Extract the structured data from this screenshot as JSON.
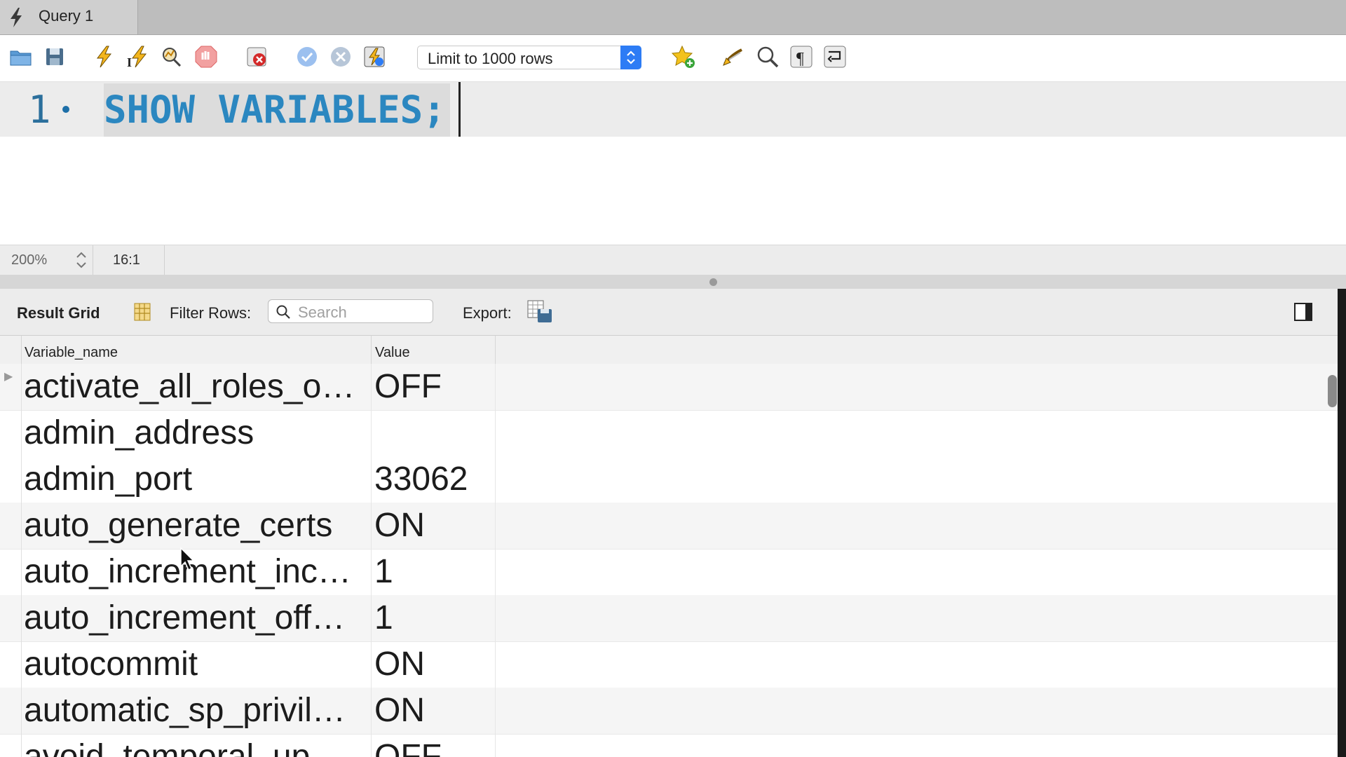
{
  "tab": {
    "label": "Query 1"
  },
  "toolbar": {
    "buttons": [
      {
        "name": "open-file-icon"
      },
      {
        "name": "save-icon"
      },
      {
        "name": "execute-icon"
      },
      {
        "name": "execute-current-icon"
      },
      {
        "name": "explain-icon"
      },
      {
        "name": "stop-icon"
      },
      {
        "name": "toggle-continue-on-error-icon"
      },
      {
        "name": "commit-icon"
      },
      {
        "name": "rollback-icon"
      },
      {
        "name": "autocommit-icon"
      },
      {
        "name": "add-snippet-icon"
      },
      {
        "name": "beautify-icon"
      },
      {
        "name": "find-icon"
      },
      {
        "name": "invisible-chars-icon"
      },
      {
        "name": "wrap-lines-icon"
      }
    ],
    "limit_select": {
      "value": "Limit to 1000 rows"
    }
  },
  "editor": {
    "line_number": "1",
    "sql": "SHOW VARIABLES;"
  },
  "status": {
    "zoom": "200%",
    "cursor_position": "16:1"
  },
  "result_toolbar": {
    "title": "Result Grid",
    "filter_label": "Filter Rows:",
    "search_placeholder": "Search",
    "export_label": "Export:"
  },
  "grid": {
    "columns": [
      "Variable_name",
      "Value"
    ],
    "rows": [
      {
        "name": "activate_all_roles_o…",
        "value": "OFF"
      },
      {
        "name": "admin_address",
        "value": ""
      },
      {
        "name": "admin_port",
        "value": "33062"
      },
      {
        "name": "auto_generate_certs",
        "value": "ON"
      },
      {
        "name": "auto_increment_inc…",
        "value": "1"
      },
      {
        "name": "auto_increment_off…",
        "value": "1"
      },
      {
        "name": "autocommit",
        "value": "ON"
      },
      {
        "name": "automatic_sp_privil…",
        "value": "ON"
      },
      {
        "name": "avoid_temporal_up…",
        "value": "OFF"
      }
    ]
  },
  "colors": {
    "accent": "#2d7cf5",
    "sql_keyword": "#2b87c0",
    "tab_bar": "#bdbdbd"
  }
}
